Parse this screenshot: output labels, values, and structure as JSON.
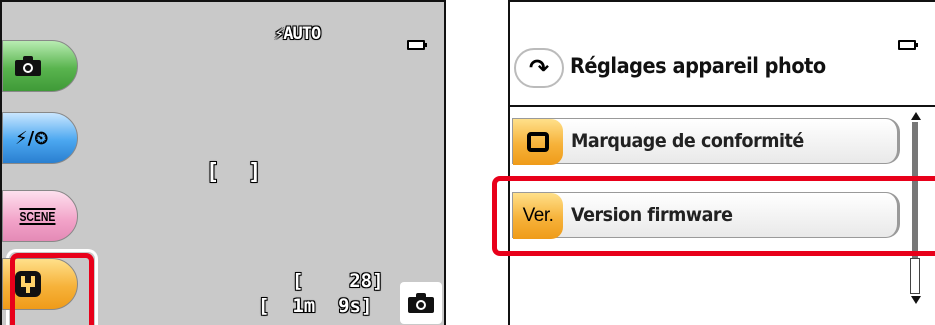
{
  "camera_screen": {
    "flash_mode": "⚡AUTO",
    "af_bracket_left": "[",
    "af_bracket_right": "]",
    "exposures_remaining": "[    28]",
    "recording_time": "[  1m  9s]",
    "tabs": [
      {
        "icon": "camera-icon"
      },
      {
        "icon": "flash-self-timer-icon",
        "label": "⚡/⏲"
      },
      {
        "icon": "scene-icon",
        "label": "SCENE"
      },
      {
        "icon": "wrench-icon"
      }
    ],
    "highlighted_tab": "setup"
  },
  "setup_menu": {
    "back_icon": "back-arrow-icon",
    "back_glyph": "↶",
    "title": "Réglages appareil photo",
    "items": [
      {
        "icon": "square-icon",
        "label": "Marquage de conformité"
      },
      {
        "badge": "Ver.",
        "label": "Version firmware"
      }
    ],
    "highlighted_item": 1
  },
  "colors": {
    "highlight": "#e8001a",
    "tab_shoot": "#59b44e",
    "tab_flash": "#4ba7f0",
    "tab_scene": "#f2a2c8",
    "tab_setup": "#f6b23a"
  }
}
